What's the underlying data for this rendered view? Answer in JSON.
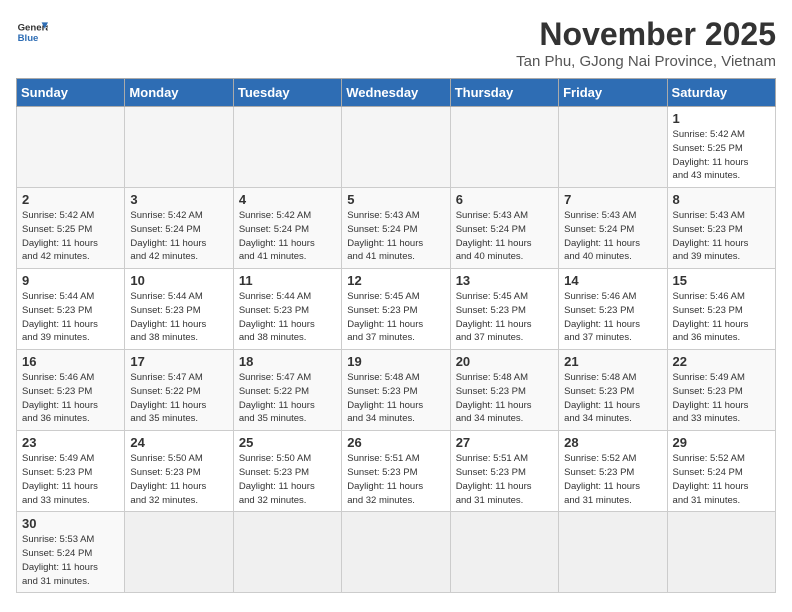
{
  "header": {
    "logo_general": "General",
    "logo_blue": "Blue",
    "month_title": "November 2025",
    "location": "Tan Phu, GJong Nai Province, Vietnam"
  },
  "weekdays": [
    "Sunday",
    "Monday",
    "Tuesday",
    "Wednesday",
    "Thursday",
    "Friday",
    "Saturday"
  ],
  "weeks": [
    [
      {
        "day": "",
        "info": ""
      },
      {
        "day": "",
        "info": ""
      },
      {
        "day": "",
        "info": ""
      },
      {
        "day": "",
        "info": ""
      },
      {
        "day": "",
        "info": ""
      },
      {
        "day": "",
        "info": ""
      },
      {
        "day": "1",
        "info": "Sunrise: 5:42 AM\nSunset: 5:25 PM\nDaylight: 11 hours\nand 43 minutes."
      }
    ],
    [
      {
        "day": "2",
        "info": "Sunrise: 5:42 AM\nSunset: 5:25 PM\nDaylight: 11 hours\nand 42 minutes."
      },
      {
        "day": "3",
        "info": "Sunrise: 5:42 AM\nSunset: 5:24 PM\nDaylight: 11 hours\nand 42 minutes."
      },
      {
        "day": "4",
        "info": "Sunrise: 5:42 AM\nSunset: 5:24 PM\nDaylight: 11 hours\nand 41 minutes."
      },
      {
        "day": "5",
        "info": "Sunrise: 5:43 AM\nSunset: 5:24 PM\nDaylight: 11 hours\nand 41 minutes."
      },
      {
        "day": "6",
        "info": "Sunrise: 5:43 AM\nSunset: 5:24 PM\nDaylight: 11 hours\nand 40 minutes."
      },
      {
        "day": "7",
        "info": "Sunrise: 5:43 AM\nSunset: 5:24 PM\nDaylight: 11 hours\nand 40 minutes."
      },
      {
        "day": "8",
        "info": "Sunrise: 5:43 AM\nSunset: 5:23 PM\nDaylight: 11 hours\nand 39 minutes."
      }
    ],
    [
      {
        "day": "9",
        "info": "Sunrise: 5:44 AM\nSunset: 5:23 PM\nDaylight: 11 hours\nand 39 minutes."
      },
      {
        "day": "10",
        "info": "Sunrise: 5:44 AM\nSunset: 5:23 PM\nDaylight: 11 hours\nand 38 minutes."
      },
      {
        "day": "11",
        "info": "Sunrise: 5:44 AM\nSunset: 5:23 PM\nDaylight: 11 hours\nand 38 minutes."
      },
      {
        "day": "12",
        "info": "Sunrise: 5:45 AM\nSunset: 5:23 PM\nDaylight: 11 hours\nand 37 minutes."
      },
      {
        "day": "13",
        "info": "Sunrise: 5:45 AM\nSunset: 5:23 PM\nDaylight: 11 hours\nand 37 minutes."
      },
      {
        "day": "14",
        "info": "Sunrise: 5:46 AM\nSunset: 5:23 PM\nDaylight: 11 hours\nand 37 minutes."
      },
      {
        "day": "15",
        "info": "Sunrise: 5:46 AM\nSunset: 5:23 PM\nDaylight: 11 hours\nand 36 minutes."
      }
    ],
    [
      {
        "day": "16",
        "info": "Sunrise: 5:46 AM\nSunset: 5:23 PM\nDaylight: 11 hours\nand 36 minutes."
      },
      {
        "day": "17",
        "info": "Sunrise: 5:47 AM\nSunset: 5:22 PM\nDaylight: 11 hours\nand 35 minutes."
      },
      {
        "day": "18",
        "info": "Sunrise: 5:47 AM\nSunset: 5:22 PM\nDaylight: 11 hours\nand 35 minutes."
      },
      {
        "day": "19",
        "info": "Sunrise: 5:48 AM\nSunset: 5:23 PM\nDaylight: 11 hours\nand 34 minutes."
      },
      {
        "day": "20",
        "info": "Sunrise: 5:48 AM\nSunset: 5:23 PM\nDaylight: 11 hours\nand 34 minutes."
      },
      {
        "day": "21",
        "info": "Sunrise: 5:48 AM\nSunset: 5:23 PM\nDaylight: 11 hours\nand 34 minutes."
      },
      {
        "day": "22",
        "info": "Sunrise: 5:49 AM\nSunset: 5:23 PM\nDaylight: 11 hours\nand 33 minutes."
      }
    ],
    [
      {
        "day": "23",
        "info": "Sunrise: 5:49 AM\nSunset: 5:23 PM\nDaylight: 11 hours\nand 33 minutes."
      },
      {
        "day": "24",
        "info": "Sunrise: 5:50 AM\nSunset: 5:23 PM\nDaylight: 11 hours\nand 32 minutes."
      },
      {
        "day": "25",
        "info": "Sunrise: 5:50 AM\nSunset: 5:23 PM\nDaylight: 11 hours\nand 32 minutes."
      },
      {
        "day": "26",
        "info": "Sunrise: 5:51 AM\nSunset: 5:23 PM\nDaylight: 11 hours\nand 32 minutes."
      },
      {
        "day": "27",
        "info": "Sunrise: 5:51 AM\nSunset: 5:23 PM\nDaylight: 11 hours\nand 31 minutes."
      },
      {
        "day": "28",
        "info": "Sunrise: 5:52 AM\nSunset: 5:23 PM\nDaylight: 11 hours\nand 31 minutes."
      },
      {
        "day": "29",
        "info": "Sunrise: 5:52 AM\nSunset: 5:24 PM\nDaylight: 11 hours\nand 31 minutes."
      }
    ],
    [
      {
        "day": "30",
        "info": "Sunrise: 5:53 AM\nSunset: 5:24 PM\nDaylight: 11 hours\nand 31 minutes."
      },
      {
        "day": "",
        "info": ""
      },
      {
        "day": "",
        "info": ""
      },
      {
        "day": "",
        "info": ""
      },
      {
        "day": "",
        "info": ""
      },
      {
        "day": "",
        "info": ""
      },
      {
        "day": "",
        "info": ""
      }
    ]
  ]
}
